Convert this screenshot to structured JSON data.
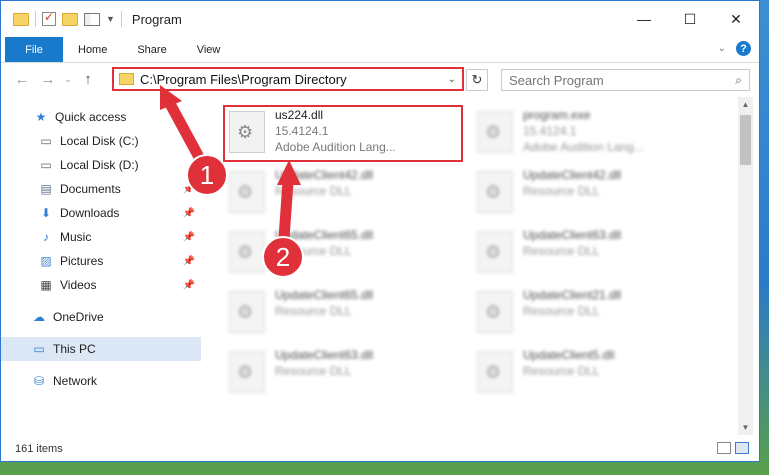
{
  "window": {
    "title": "Program",
    "controls": {
      "minimize": "—",
      "maximize": "☐",
      "close": "✕"
    }
  },
  "ribbon": {
    "tabs": [
      "File",
      "Home",
      "Share",
      "View"
    ],
    "help": "?"
  },
  "address": {
    "path": "C:\\Program Files\\Program Directory",
    "search_placeholder": "Search Program"
  },
  "sidebar": {
    "items": [
      {
        "label": "Quick access",
        "icon": "star-icon",
        "pinned": false
      },
      {
        "label": "Local Disk (C:)",
        "icon": "drive-icon",
        "pinned": true
      },
      {
        "label": "Local Disk (D:)",
        "icon": "drive-icon",
        "pinned": true
      },
      {
        "label": "Documents",
        "icon": "documents-icon",
        "pinned": true
      },
      {
        "label": "Downloads",
        "icon": "download-icon",
        "pinned": true
      },
      {
        "label": "Music",
        "icon": "music-icon",
        "pinned": true
      },
      {
        "label": "Pictures",
        "icon": "pictures-icon",
        "pinned": true
      },
      {
        "label": "Videos",
        "icon": "videos-icon",
        "pinned": true
      },
      {
        "label": "OneDrive",
        "icon": "cloud-icon",
        "pinned": false
      },
      {
        "label": "This PC",
        "icon": "computer-icon",
        "pinned": false
      },
      {
        "label": "Network",
        "icon": "network-icon",
        "pinned": false
      }
    ]
  },
  "files": [
    {
      "name": "us224.dll",
      "line2": "15.4124.1",
      "line3": "Adobe Audition Lang...",
      "highlighted": true
    },
    {
      "name": "program.exe",
      "line2": "15.4124.1",
      "line3": "Adobe Audition Lang..."
    },
    {
      "name": "UpdateClient42.dll",
      "line2": "Resource DLL"
    },
    {
      "name": "UpdateClient42.dll",
      "line2": "Resource DLL"
    },
    {
      "name": "UpdateClient65.dll",
      "line2": "Resource DLL"
    },
    {
      "name": "UpdateClient63.dll",
      "line2": "Resource DLL"
    },
    {
      "name": "UpdateClient65.dll",
      "line2": "Resource DLL"
    },
    {
      "name": "UpdateClient21.dll",
      "line2": "Resource DLL"
    },
    {
      "name": "UpdateClient63.dll",
      "line2": "Resource DLL"
    },
    {
      "name": "UpdateClient5.dll",
      "line2": "Resource DLL"
    }
  ],
  "status": {
    "count": "161 items"
  },
  "annotations": {
    "step1": "1",
    "step2": "2",
    "color": "#e0313b"
  }
}
